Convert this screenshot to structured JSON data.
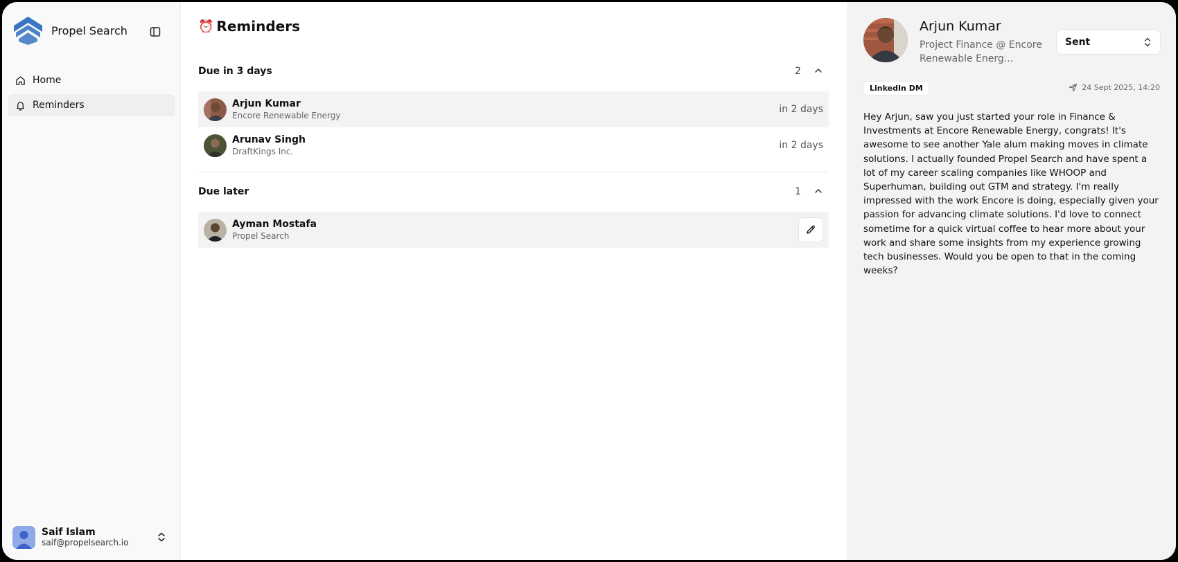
{
  "app": {
    "name": "Propel Search"
  },
  "sidebar": {
    "items": [
      {
        "label": "Home",
        "icon": "home-icon",
        "active": false
      },
      {
        "label": "Reminders",
        "icon": "bell-icon",
        "active": true
      }
    ],
    "user": {
      "name": "Saif Islam",
      "email": "saif@propelsearch.io"
    }
  },
  "main": {
    "title": "Reminders",
    "title_icon": "⏰",
    "sections": [
      {
        "title": "Due in 3 days",
        "count": "2",
        "rows": [
          {
            "name": "Arjun Kumar",
            "company": "Encore Renewable Energy",
            "due": "in 2 days"
          },
          {
            "name": "Arunav Singh",
            "company": "DraftKings Inc.",
            "due": "in 2 days"
          }
        ]
      },
      {
        "title": "Due later",
        "count": "1",
        "rows": [
          {
            "name": "Ayman Mostafa",
            "company": "Propel Search",
            "due": ""
          }
        ]
      }
    ]
  },
  "detail": {
    "name": "Arjun Kumar",
    "title": "Project Finance @ Encore Renewable Energ...",
    "status": "Sent",
    "channel": "LinkedIn DM",
    "sent_at": "24 Sept 2025, 14:20",
    "message": "Hey Arjun, saw you just started your role in Finance & Investments at Encore Renewable Energy, congrats! It's awesome to see another Yale alum making moves in climate solutions. I actually founded Propel Search and have spent a lot of my career scaling companies like WHOOP and Superhuman, building out GTM and strategy. I'm really impressed with the work Encore is doing, especially given your passion for advancing climate solutions. I'd love to connect sometime for a quick virtual coffee to hear more about your work and share some insights from my experience growing tech businesses. Would you be open to that in the coming weeks?"
  },
  "colors": {
    "brand_blue": "#3a74c4",
    "sidebar_bg": "#f9f9f9",
    "panel_bg": "#f3f3f3"
  }
}
